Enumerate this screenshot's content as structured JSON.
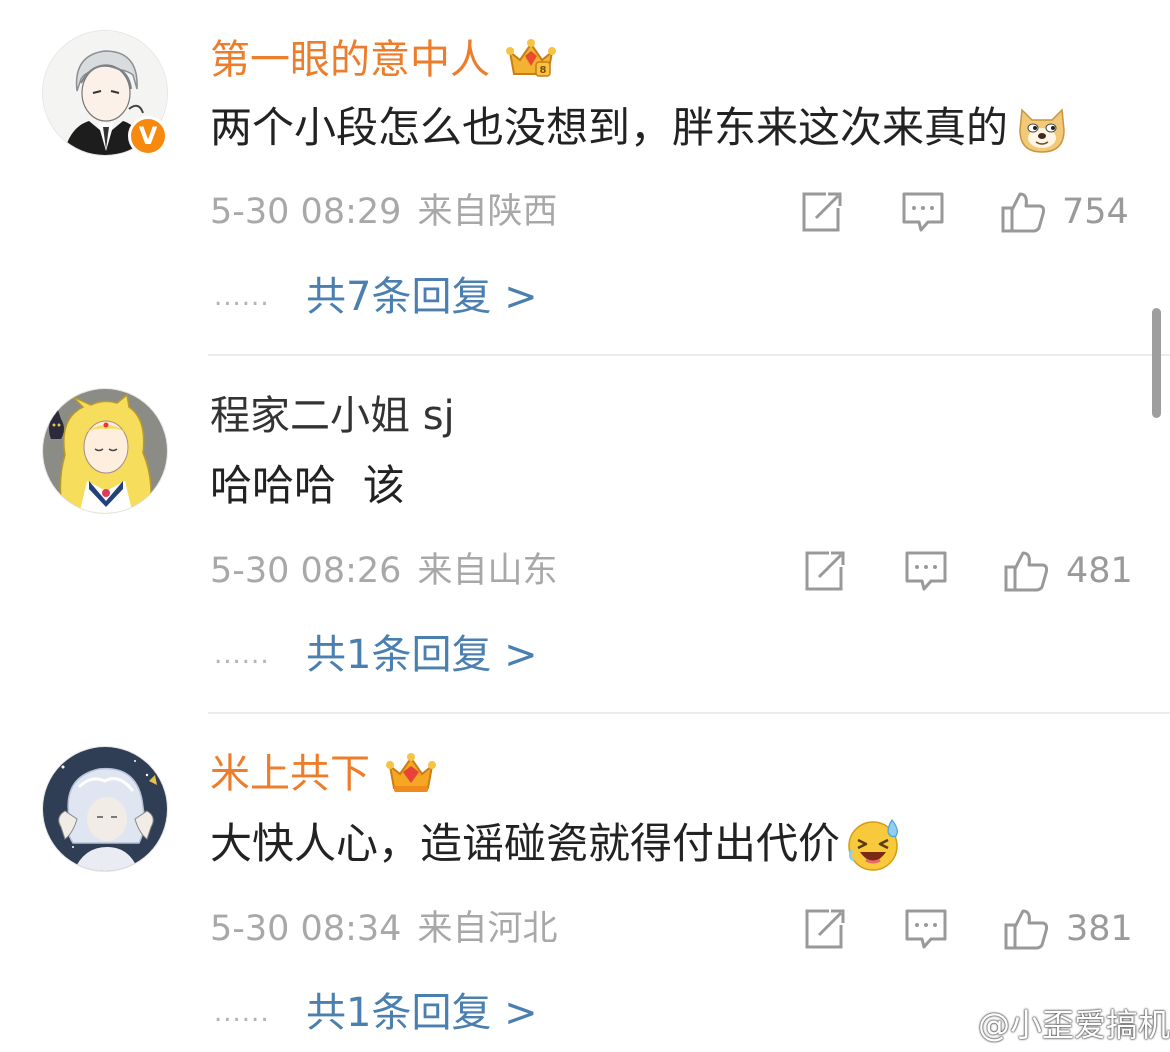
{
  "comments": [
    {
      "username": "第一眼的意中人",
      "name_style": "vip",
      "has_crown": true,
      "verified_badge": "V",
      "text": "两个小段怎么也没想到，胖东来这次来真的",
      "emoji": "doge-emoji",
      "date": "5-30 08:29",
      "location": "来自陕西",
      "likes": "754",
      "replies": "共7条回复 >"
    },
    {
      "username": "程家二小姐 sj",
      "name_style": "plain",
      "has_crown": false,
      "text": "哈哈哈  该",
      "date": "5-30 08:26",
      "location": "来自山东",
      "likes": "481",
      "replies": "共1条回复 >"
    },
    {
      "username": "米上共下",
      "name_style": "vip",
      "has_crown": true,
      "text": "大快人心，造谣碰瓷就得付出代价",
      "emoji": "laughing-sweat-emoji",
      "date": "5-30 08:34",
      "location": "来自河北",
      "likes": "381",
      "replies": "共1条回复 >"
    }
  ],
  "reply_dots": "......",
  "watermark": "@小歪爱搞机",
  "colors": {
    "vip_name": "#ee7d2b",
    "reply_link": "#4a7fb0",
    "meta_gray": "#a8a8a8",
    "badge_orange": "#f7890f"
  }
}
